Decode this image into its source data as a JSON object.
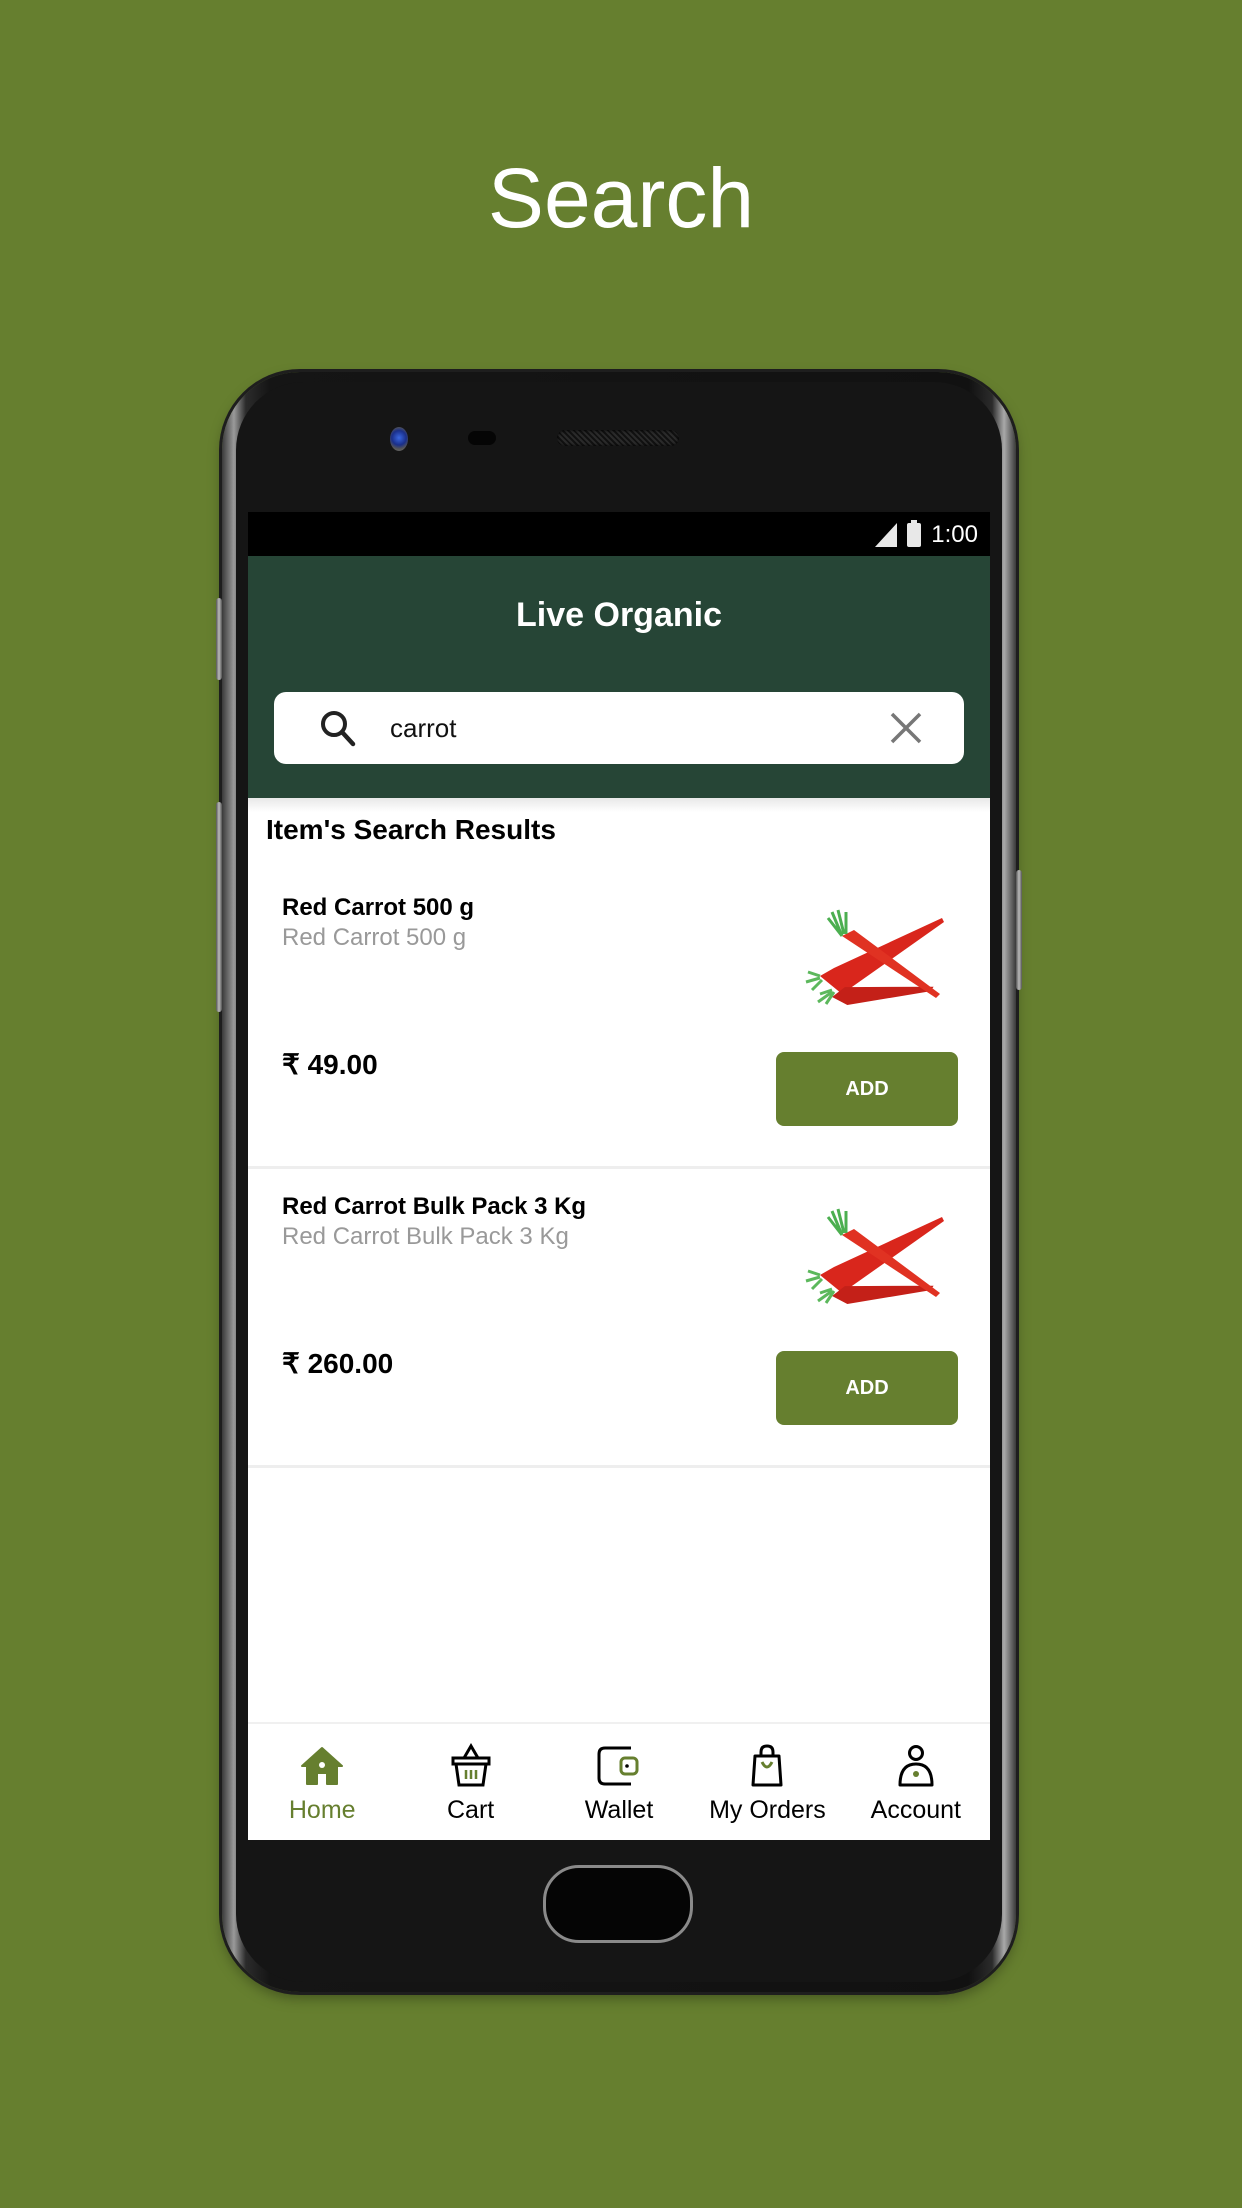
{
  "promo": {
    "title": "Search"
  },
  "statusbar": {
    "time": "1:00"
  },
  "appbar": {
    "title": "Live Organic"
  },
  "search": {
    "value": "carrot",
    "icon": "search-icon",
    "clear_icon": "close-icon"
  },
  "results": {
    "title": "Item's Search Results",
    "items": [
      {
        "name": "Red Carrot 500 g",
        "subtitle": "Red Carrot 500 g",
        "price": "₹ 49.00",
        "button": "ADD",
        "image": "red-carrot-image"
      },
      {
        "name": "Red Carrot Bulk Pack 3 Kg",
        "subtitle": "Red Carrot Bulk Pack 3 Kg",
        "price": "₹ 260.00",
        "button": "ADD",
        "image": "red-carrot-image"
      }
    ]
  },
  "nav": {
    "items": [
      {
        "label": "Home",
        "icon": "home-icon",
        "active": true
      },
      {
        "label": "Cart",
        "icon": "basket-icon",
        "active": false
      },
      {
        "label": "Wallet",
        "icon": "wallet-icon",
        "active": false
      },
      {
        "label": "My Orders",
        "icon": "shopping-bag-icon",
        "active": false
      },
      {
        "label": "Account",
        "icon": "user-icon",
        "active": false
      }
    ]
  },
  "colors": {
    "background": "#667f2f",
    "appbar": "#264536",
    "accent": "#667f2f"
  }
}
